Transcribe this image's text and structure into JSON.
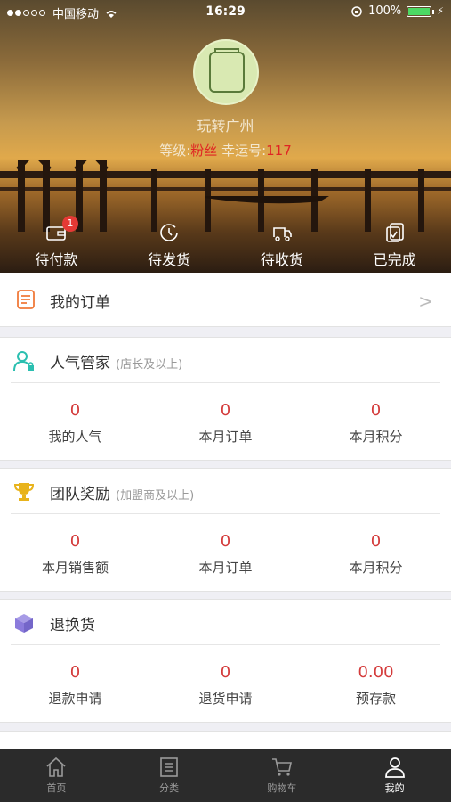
{
  "status_bar": {
    "carrier": "中国移动",
    "time": "16:29",
    "battery": "100%"
  },
  "profile": {
    "name": "玩转广州",
    "level_label": "等级:",
    "level_value": "粉丝",
    "lucky_label": "幸运号:",
    "lucky_value": "117"
  },
  "order_tabs": [
    {
      "label": "待付款",
      "badge": "1",
      "icon": "wallet-icon"
    },
    {
      "label": "待发货",
      "icon": "clock-icon"
    },
    {
      "label": "待收货",
      "icon": "truck-icon"
    },
    {
      "label": "已完成",
      "icon": "done-icon"
    }
  ],
  "my_orders": {
    "label": "我的订单",
    "icon": "order-list-icon"
  },
  "sections": [
    {
      "title": "人气管家",
      "subtitle": "(店长及以上)",
      "icon": "user-lock-icon",
      "icon_color": "#2bbfb0",
      "stats": [
        {
          "value": "0",
          "label": "我的人气"
        },
        {
          "value": "0",
          "label": "本月订单"
        },
        {
          "value": "0",
          "label": "本月积分"
        }
      ]
    },
    {
      "title": "团队奖励",
      "subtitle": "(加盟商及以上)",
      "icon": "trophy-icon",
      "icon_color": "#e8b31c",
      "stats": [
        {
          "value": "0",
          "label": "本月销售额"
        },
        {
          "value": "0",
          "label": "本月订单"
        },
        {
          "value": "0",
          "label": "本月积分"
        }
      ]
    },
    {
      "title": "退换货",
      "subtitle": "",
      "icon": "box-icon",
      "icon_color": "#8b7bdc",
      "stats": [
        {
          "value": "0",
          "label": "退款申请"
        },
        {
          "value": "0",
          "label": "退货申请"
        },
        {
          "value": "0.00",
          "label": "预存款"
        }
      ]
    }
  ],
  "tabbar": [
    {
      "label": "首页",
      "icon": "home-icon",
      "active": false
    },
    {
      "label": "分类",
      "icon": "category-icon",
      "active": false
    },
    {
      "label": "购物车",
      "icon": "cart-icon",
      "active": false
    },
    {
      "label": "我的",
      "icon": "user-icon",
      "active": true
    }
  ],
  "colors": {
    "accent_red": "#d43b3b",
    "tabbar_bg": "#2b2b2b",
    "badge": "#e53935"
  }
}
